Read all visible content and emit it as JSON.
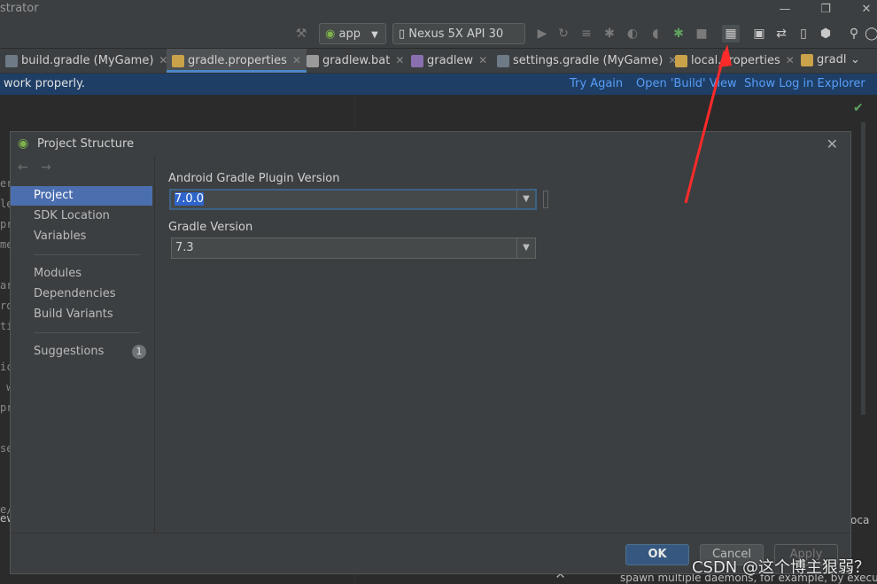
{
  "window": {
    "title": "strator"
  },
  "toolbar": {
    "run_config": "app",
    "device": "Nexus 5X API 30"
  },
  "tabs": [
    {
      "label": "build.gradle (MyGame)",
      "active": false
    },
    {
      "label": "gradle.properties",
      "active": true
    },
    {
      "label": "gradlew.bat",
      "active": false
    },
    {
      "label": "gradlew",
      "active": false
    },
    {
      "label": "settings.gradle (MyGame)",
      "active": false
    },
    {
      "label": "local.properties",
      "active": false
    },
    {
      "label": "gradl",
      "active": false
    }
  ],
  "notification": {
    "message": "work properly.",
    "try_again": "Try Again",
    "open_build": "Open 'Build' View",
    "show_log": "Show Log in Explorer"
  },
  "dialog": {
    "title": "Project Structure",
    "nav": {
      "project": "Project",
      "sdk_location": "SDK Location",
      "variables": "Variables",
      "modules": "Modules",
      "dependencies": "Dependencies",
      "build_variants": "Build Variants",
      "suggestions": "Suggestions",
      "suggestions_count": "1"
    },
    "agp_label": "Android Gradle Plugin Version",
    "agp_value": "7.0.0",
    "gradle_label": "Gradle Version",
    "gradle_value": "7.3",
    "ok": "OK",
    "cancel": "Cancel",
    "apply": "Apply"
  },
  "bottom_text": "spawn multiple daemons, for example, by execu",
  "watermark": "CSDN @这个博主狠弱？",
  "colors": {
    "accent": "#4b6eaf",
    "annotation_arrow": "#ff2a2a"
  }
}
